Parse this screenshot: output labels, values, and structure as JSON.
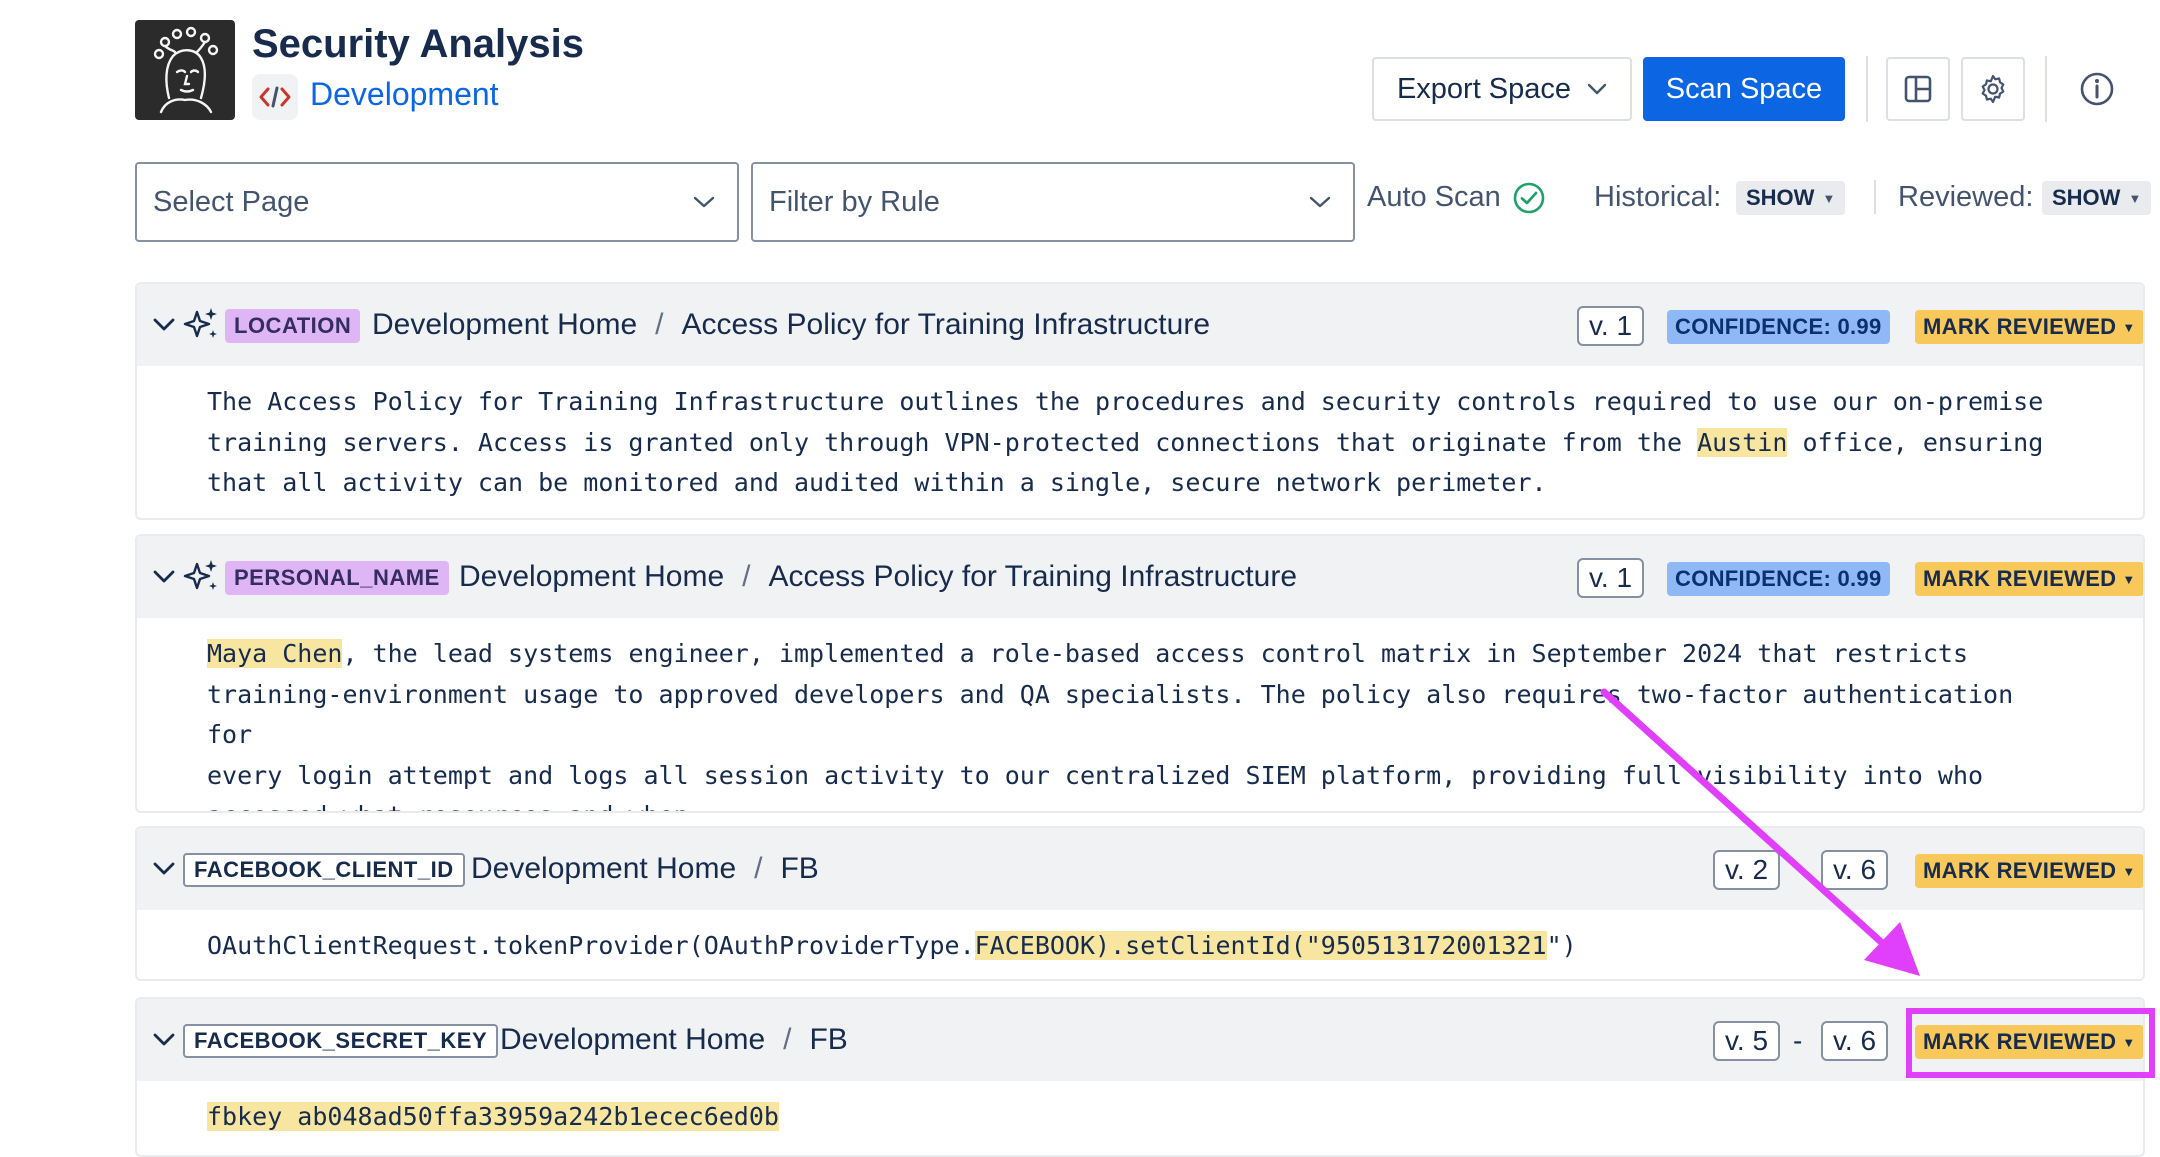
{
  "header": {
    "title": "Security Analysis",
    "space_name": "Development",
    "space_icon": "code-icon",
    "logo": "portrait-logo",
    "export_label": "Export Space",
    "scan_label": "Scan Space"
  },
  "filters": {
    "page_placeholder": "Select Page",
    "rule_placeholder": "Filter by Rule",
    "auto_scan_label": "Auto Scan",
    "historical_label": "Historical:",
    "historical_value": "SHOW",
    "reviewed_label": "Reviewed:",
    "reviewed_value": "SHOW"
  },
  "findings": [
    {
      "rule": "LOCATION",
      "page_root": "Development Home",
      "separator": "/",
      "page_title": "Access Policy for Training Infrastructure",
      "version": "v. 1",
      "confidence": "CONFIDENCE: 0.99",
      "mark_label": "MARK REVIEWED",
      "text_before": "The Access Policy for Training Infrastructure outlines the procedures and security controls required to use our on-premise\ntraining servers. Access is granted only through VPN-protected connections that originate from the ",
      "match": "Austin",
      "text_after": " office, ensuring\nthat all activity can be monitored and audited within a single, secure network perimeter."
    },
    {
      "rule": "PERSONAL_NAME",
      "page_root": "Development Home",
      "separator": "/",
      "page_title": "Access Policy for Training Infrastructure",
      "version": "v. 1",
      "confidence": "CONFIDENCE: 0.99",
      "mark_label": "MARK REVIEWED",
      "text_before": "",
      "match": "Maya Chen",
      "text_after": ", the lead systems engineer, implemented a role-based access control matrix in September 2024 that restricts\ntraining-environment usage to approved developers and QA specialists. The policy also requires two-factor authentication for\nevery login attempt and logs all session activity to our centralized SIEM platform, providing full visibility into who\naccessed what resources and when."
    },
    {
      "rule": "FACEBOOK_CLIENT_ID",
      "page_root": "Development Home",
      "separator": "/",
      "page_title": "FB",
      "version_from": "v. 2",
      "version_to": "v. 6",
      "mark_label": "MARK REVIEWED",
      "text_before": "OAuthClientRequest.tokenProvider(OAuthProviderType.",
      "match": "FACEBOOK).setClientId(\"950513172001321",
      "text_after": "\")"
    },
    {
      "rule": "FACEBOOK_SECRET_KEY",
      "page_root": "Development Home",
      "separator": "/",
      "page_title": "FB",
      "version_from": "v. 5",
      "range_dash": "-",
      "version_to": "v. 6",
      "mark_label": "MARK REVIEWED",
      "text_before": "",
      "match": "fbkey ab048ad50ffa33959a242b1ecec6ed0b",
      "text_after": ""
    }
  ],
  "colors": {
    "primary": "#0c66e4",
    "rule_tag": "#dfb6f5",
    "confidence": "#8fb8f6",
    "mark_reviewed": "#f8c95a",
    "highlight": "#f8e6a0",
    "annotation": "#e040fb"
  }
}
